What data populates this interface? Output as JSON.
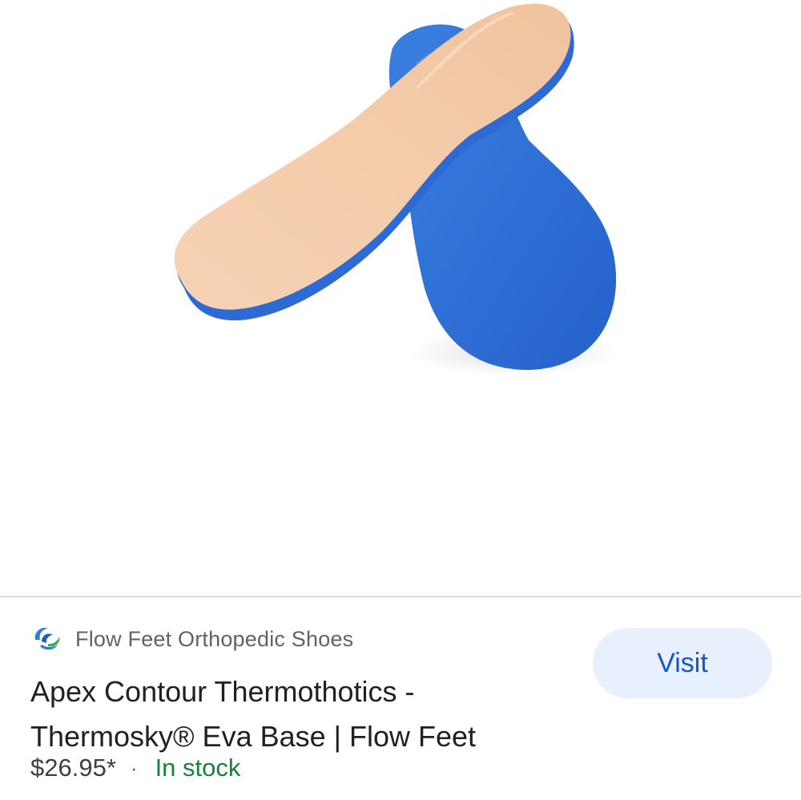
{
  "product_image": {
    "icon": "insole-product-image",
    "colors": {
      "top_layer": "#f2c9a6",
      "base": "#2f6fd6",
      "base_shade": "#1f56b8"
    }
  },
  "merchant": {
    "logo_icon": "flow-feet-logo-icon",
    "name": "Flow Feet Orthopedic Shoes"
  },
  "product": {
    "title": "Apex Contour Thermothotics - Thermosky® Eva Base | Flow Feet",
    "price": "$26.95*",
    "separator": "·",
    "availability": "In stock"
  },
  "actions": {
    "visit_label": "Visit"
  },
  "colors": {
    "accent": "#1a57c6",
    "button_bg": "#e8f0fe",
    "stock_green": "#188038",
    "secondary_text": "#5f6368",
    "primary_text": "#202124"
  }
}
